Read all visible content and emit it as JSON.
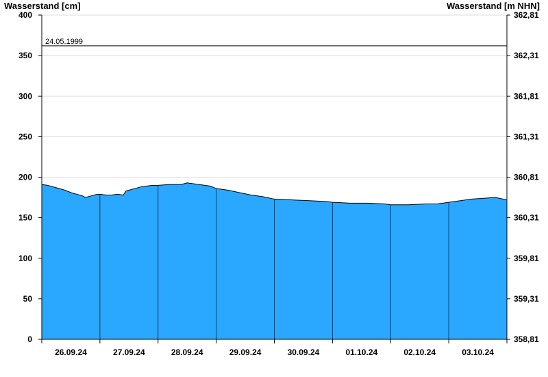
{
  "chart_data": {
    "type": "area",
    "ylabel": "Wasserstand [cm]",
    "ylabel_right": "Wasserstand [m NHN]",
    "ylim": [
      0,
      400
    ],
    "yticks": [
      0,
      50,
      100,
      150,
      200,
      250,
      300,
      350,
      400
    ],
    "yticks_right": [
      "358,81",
      "359,31",
      "359,81",
      "360,31",
      "360,81",
      "361,31",
      "361,81",
      "362,31",
      "362,81"
    ],
    "x_labels": [
      "26.09.24",
      "27.09.24",
      "28.09.24",
      "29.09.24",
      "30.09.24",
      "01.10.24",
      "02.10.24",
      "03.10.24"
    ],
    "grid": "horizontal",
    "fill_color": "#2aa7ff",
    "reference_line": {
      "label": "24.05.1999",
      "value": 362
    },
    "series": [
      {
        "x_day": [
          0,
          0.1,
          0.25,
          0.4,
          0.5,
          0.6,
          0.7,
          0.75,
          0.85,
          0.95,
          1.0,
          1.1,
          1.2,
          1.3,
          1.4,
          1.45,
          1.6,
          1.7,
          1.8,
          1.9,
          2.0,
          2.2,
          2.4,
          2.5,
          2.7,
          2.9,
          3.0,
          3.2,
          3.4,
          3.6,
          3.8,
          4.0,
          4.3,
          4.6,
          4.9,
          5.0,
          5.3,
          5.6,
          5.9,
          6.0,
          6.3,
          6.6,
          6.8,
          7.0,
          7.2,
          7.4,
          7.6,
          7.8,
          8.0
        ],
        "values": [
          191,
          190,
          187,
          184,
          181,
          179,
          177,
          175,
          177,
          179,
          179,
          178,
          178,
          179,
          178,
          183,
          186,
          188,
          189,
          190,
          190,
          191,
          191,
          193,
          191,
          189,
          186,
          184,
          181,
          178,
          176,
          173,
          172,
          171,
          170,
          169,
          168,
          168,
          167,
          166,
          166,
          167,
          167,
          169,
          171,
          173,
          174,
          175,
          172
        ]
      }
    ]
  }
}
